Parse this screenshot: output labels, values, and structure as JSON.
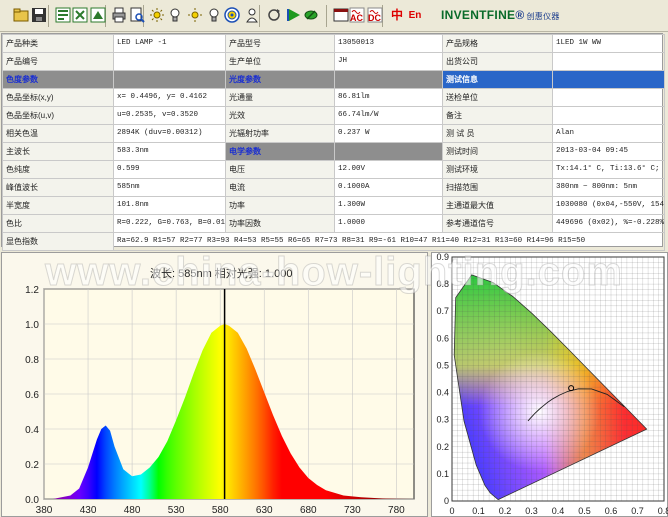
{
  "toolbar": {
    "icons": [
      "open-icon",
      "save-icon",
      "export-icon",
      "import-icon",
      "export2-icon",
      "print-icon",
      "print-preview-icon",
      "lamp-icon",
      "bulb-icon",
      "lamp-power-icon",
      "bulb2-icon",
      "target-icon",
      "user-icon",
      "refresh-icon",
      "play-icon",
      "pen-icon",
      "window-icon",
      "ac-icon",
      "dc-icon",
      "chinese-icon",
      "english-icon"
    ],
    "ac_label": "AC",
    "dc_label": "DC",
    "zh_label": "中",
    "en_label": "En",
    "brand_main": "INVENTFINE",
    "brand_tm": "®",
    "brand_cn": "创惠仪器"
  },
  "table": {
    "rows": [
      [
        {
          "t": "产品种类",
          "k": "lab"
        },
        {
          "t": "LED LAMP -1",
          "k": "val"
        },
        {
          "t": "产品型号",
          "k": "lab"
        },
        {
          "t": "13050013",
          "k": "val"
        },
        {
          "t": "产品规格",
          "k": "lab"
        },
        {
          "t": "1LED 1W WW",
          "k": "val"
        }
      ],
      [
        {
          "t": "产品编号",
          "k": "lab"
        },
        {
          "t": "",
          "k": "val"
        },
        {
          "t": "生产单位",
          "k": "lab"
        },
        {
          "t": "JH",
          "k": "val"
        },
        {
          "t": "出货公司",
          "k": "lab"
        },
        {
          "t": "",
          "k": "val"
        }
      ],
      [
        {
          "t": "色度参数",
          "k": "sect"
        },
        {
          "t": "",
          "k": "sect-gray"
        },
        {
          "t": "光度参数",
          "k": "sect"
        },
        {
          "t": "",
          "k": "sect-gray"
        },
        {
          "t": "测试信息",
          "k": "sect-blue"
        },
        {
          "t": "",
          "k": "sect-blue"
        }
      ],
      [
        {
          "t": "色品坐标(x,y)",
          "k": "lab"
        },
        {
          "t": "x= 0.4496, y= 0.4162",
          "k": "val"
        },
        {
          "t": "光通量",
          "k": "lab"
        },
        {
          "t": "86.81lm",
          "k": "val"
        },
        {
          "t": "送检单位",
          "k": "lab"
        },
        {
          "t": "",
          "k": "val"
        }
      ],
      [
        {
          "t": "色品坐标(u,v)",
          "k": "lab"
        },
        {
          "t": "u=0.2535, v=0.3520",
          "k": "val"
        },
        {
          "t": "光效",
          "k": "lab"
        },
        {
          "t": "66.74lm/W",
          "k": "val"
        },
        {
          "t": "备注",
          "k": "lab"
        },
        {
          "t": "",
          "k": "val"
        }
      ],
      [
        {
          "t": "相关色温",
          "k": "lab"
        },
        {
          "t": "2894K (duv=0.00312)",
          "k": "val"
        },
        {
          "t": "光辐射功率",
          "k": "lab"
        },
        {
          "t": "0.237 W",
          "k": "val"
        },
        {
          "t": "测 试 员",
          "k": "lab"
        },
        {
          "t": "Alan",
          "k": "val"
        }
      ],
      [
        {
          "t": "主波长",
          "k": "lab"
        },
        {
          "t": "583.3nm",
          "k": "val"
        },
        {
          "t": "电学参数",
          "k": "sect"
        },
        {
          "t": "",
          "k": "sect-gray"
        },
        {
          "t": "测试时间",
          "k": "lab"
        },
        {
          "t": "2013-03-04 09:45",
          "k": "val"
        }
      ],
      [
        {
          "t": "色纯度",
          "k": "lab"
        },
        {
          "t": "0.599",
          "k": "val"
        },
        {
          "t": "电压",
          "k": "lab"
        },
        {
          "t": "12.00V",
          "k": "val"
        },
        {
          "t": "测试环境",
          "k": "lab"
        },
        {
          "t": "Tx:14.1° C, Ti:13.6° C; %",
          "k": "val"
        }
      ],
      [
        {
          "t": "峰值波长",
          "k": "lab"
        },
        {
          "t": "585nm",
          "k": "val"
        },
        {
          "t": "电流",
          "k": "lab"
        },
        {
          "t": "0.1000A",
          "k": "val"
        },
        {
          "t": "扫描范围",
          "k": "lab"
        },
        {
          "t": "380nm ~ 800nm: 5nm",
          "k": "val"
        }
      ],
      [
        {
          "t": "半宽度",
          "k": "lab"
        },
        {
          "t": "101.8nm",
          "k": "val"
        },
        {
          "t": "功率",
          "k": "lab"
        },
        {
          "t": "1.300W",
          "k": "val"
        },
        {
          "t": "主通道最大值",
          "k": "lab"
        },
        {
          "t": "1030080 (0x04,-550V, 154)",
          "k": "val"
        }
      ],
      [
        {
          "t": "色比",
          "k": "lab"
        },
        {
          "t": "R=0.222, G=0.763, B=0.016",
          "k": "val"
        },
        {
          "t": "功率因数",
          "k": "lab"
        },
        {
          "t": "1.0000",
          "k": "val"
        },
        {
          "t": "参考通道信号",
          "k": "lab"
        },
        {
          "t": "449696 (0x02), %=-0.228%",
          "k": "val"
        }
      ]
    ],
    "ra_label": "显色指数",
    "ra_value": "Ra=62.9  R1=57 R2=77 R3=93 R4=53 R5=55 R6=65 R7=73 R8=31 R9=-61 R10=47 R11=40 R12=31 R13=60 R14=96 R15=50"
  },
  "spectrum": {
    "header": "波长: 585nm 相对光强: 1.000",
    "cursor_nm": 585
  },
  "watermark": "www.china-how-lighting.com",
  "chart_data": [
    {
      "type": "area",
      "title": "",
      "xlabel": "",
      "ylabel": "",
      "xlim": [
        380,
        800
      ],
      "ylim": [
        0,
        1.2
      ],
      "xticks": [
        380,
        430,
        480,
        530,
        580,
        630,
        680,
        730,
        780
      ],
      "yticks": [
        0,
        0.2,
        0.4,
        0.6,
        0.8,
        1.0,
        1.2
      ],
      "grid": true,
      "series": [
        {
          "x": [
            380,
            390,
            400,
            410,
            420,
            430,
            440,
            445,
            450,
            455,
            460,
            470,
            480,
            490,
            500,
            510,
            520,
            530,
            540,
            550,
            560,
            570,
            580,
            585,
            590,
            600,
            610,
            620,
            630,
            640,
            650,
            660,
            670,
            680,
            690,
            700,
            720,
            740,
            760,
            780,
            800
          ],
          "values": [
            0.0,
            0.0,
            0.01,
            0.02,
            0.06,
            0.18,
            0.34,
            0.4,
            0.42,
            0.39,
            0.3,
            0.17,
            0.13,
            0.14,
            0.18,
            0.24,
            0.33,
            0.45,
            0.58,
            0.72,
            0.85,
            0.95,
            0.99,
            1.0,
            0.99,
            0.95,
            0.86,
            0.74,
            0.61,
            0.48,
            0.36,
            0.26,
            0.18,
            0.12,
            0.08,
            0.05,
            0.02,
            0.01,
            0.004,
            0.001,
            0.0
          ]
        }
      ]
    },
    {
      "type": "scatter",
      "title": "",
      "xlabel": "",
      "ylabel": "",
      "xlim": [
        0,
        0.8
      ],
      "ylim": [
        0,
        0.9
      ],
      "xticks": [
        0,
        0.1,
        0.2,
        0.3,
        0.4,
        0.5,
        0.6,
        0.7,
        0.8
      ],
      "yticks": [
        0,
        0.1,
        0.2,
        0.3,
        0.4,
        0.5,
        0.6,
        0.7,
        0.8,
        0.9
      ],
      "grid": true,
      "series": [
        {
          "x": [
            0.4496
          ],
          "values": [
            0.4162
          ]
        }
      ]
    }
  ]
}
